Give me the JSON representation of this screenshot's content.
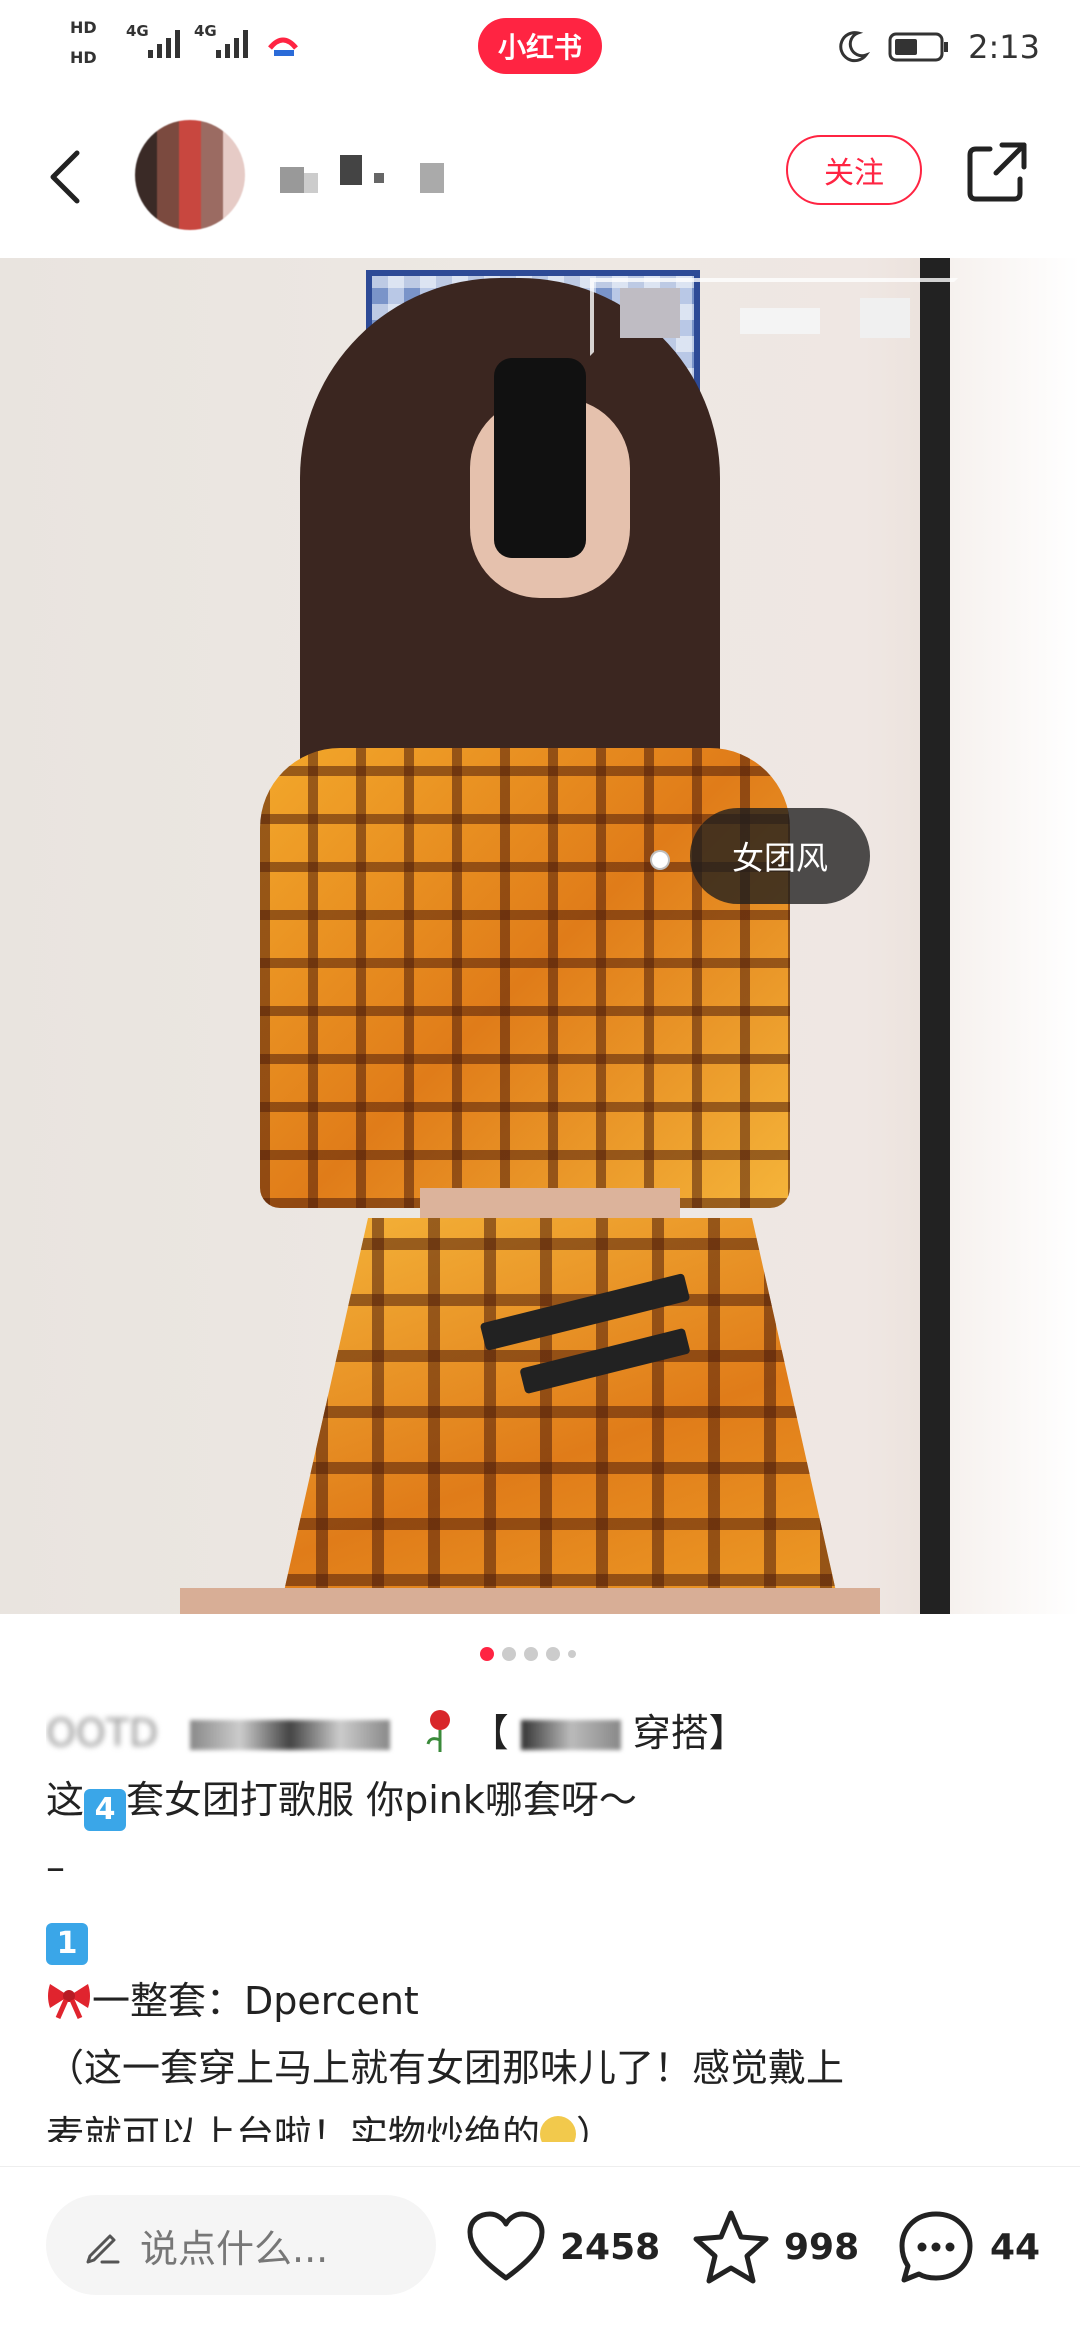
{
  "status_bar": {
    "hd1": "HD",
    "hd2": "HD",
    "net1": "4G",
    "net2": "4G",
    "app_name": "小红书",
    "time": "2:13"
  },
  "header": {
    "follow_label": "关注"
  },
  "photo": {
    "tag_label": "女团风",
    "page_count": 5,
    "current_page": 1
  },
  "post": {
    "title_partial_start": "OOTD",
    "title_partial_end": "【",
    "title_tail": "穿搭】",
    "line1_pre": "这",
    "line1_box": "4",
    "line1_post": "套女团打歌服 你pink哪套呀～",
    "line2": "–",
    "line3_box": "1",
    "line4_text": "一整套：Dpercent",
    "line5": "（这一套穿上马上就有女团那味儿了！感觉戴上",
    "line6": "麦就可以上台啦！实物炒绝的",
    "line6_end": "）"
  },
  "bottom_bar": {
    "comment_placeholder": "说点什么...",
    "likes": "2458",
    "favorites": "998",
    "comments": "44"
  },
  "colors": {
    "brand": "#ff2442"
  }
}
